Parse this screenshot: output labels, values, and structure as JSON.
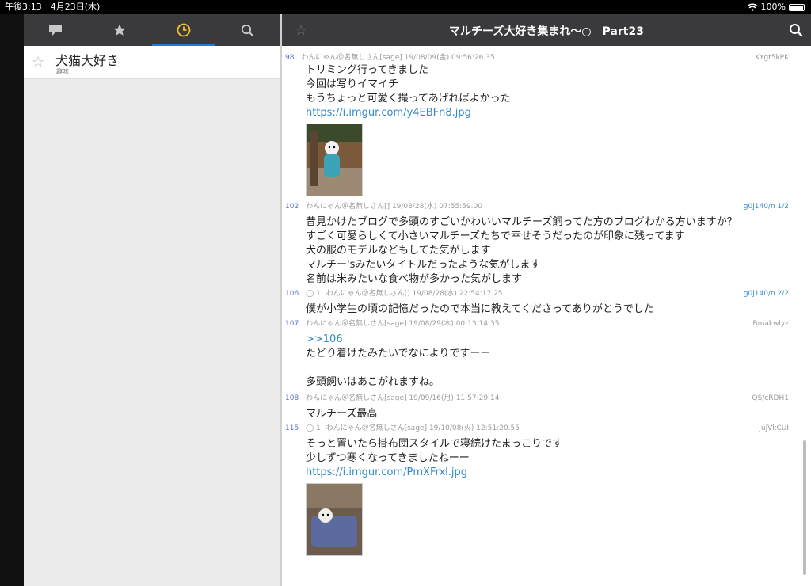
{
  "status_bar": {
    "time_date": "午後3:13　4月23日(木)",
    "battery": "100%"
  },
  "sidebar": {
    "tab_icons": [
      "speech-bubble-icon",
      "star-icon",
      "clock-icon",
      "search-icon"
    ],
    "items": [
      {
        "title": "犬猫大好き",
        "subtitle": "趣味"
      }
    ]
  },
  "thread": {
    "title": "マルチーズ大好き集まれ〜○　Part23",
    "posts": [
      {
        "num": "98",
        "reply": "",
        "meta": "わんにゃん＠名無しさん[sage]  19/08/09(金) 09:56:26.35",
        "id": "KYgt5kPK",
        "id_blue": false,
        "body": "トリミング行ってきました\n今回は写りイマイチ\nもうちょっと可愛く撮ってあげればよかった",
        "link": "https://i.imgur.com/y4EBFn8.jpg",
        "has_image": true
      },
      {
        "num": "102",
        "reply": "",
        "meta": "わんにゃん＠名無しさん[]  19/08/28(水) 07:55:59.00",
        "id": "g0j140/n 1/2",
        "id_blue": true,
        "body": "昔見かけたブログで多頭のすごいかわいいマルチーズ飼ってた方のブログわかる方いますか？\nすごく可愛らしくて小さいマルチーズたちで幸せそうだったのが印象に残ってます\n犬の服のモデルなどもしてた気がします\nマルチー'sみたいタイトルだったような気がします\n名前は米みたいな食べ物が多かった気がします",
        "link": "",
        "has_image": false
      },
      {
        "num": "106",
        "reply": "1",
        "meta": "わんにゃん＠名無しさん[]  19/08/28(水) 22:54:17.25",
        "id": "g0j140/n 2/2",
        "id_blue": true,
        "body": "僕が小学生の頃の記憶だったので本当に教えてくださってありがとうでした",
        "link": "",
        "has_image": false
      },
      {
        "num": "107",
        "reply": "",
        "meta": "わんにゃん＠名無しさん[sage]  19/08/29(木) 00:13:14.35",
        "id": "Bmakwlyz",
        "id_blue": false,
        "body": "たどり着けたみたいでなによりですーー\n\n多頭飼いはあこがれますね。",
        "quote": ">>106",
        "link": "",
        "has_image": false
      },
      {
        "num": "108",
        "reply": "",
        "meta": "わんにゃん＠名無しさん[sage]  19/09/16(月) 11:57:29.14",
        "id": "QS/cRDH1",
        "id_blue": false,
        "body": "マルチーズ最高",
        "link": "",
        "has_image": false
      },
      {
        "num": "115",
        "reply": "1",
        "meta": "わんにゃん＠名無しさん[sage]  19/10/08(火) 12:51:20.55",
        "id": "jujVkCUI",
        "id_blue": false,
        "body": "そっと置いたら掛布団スタイルで寝続けたまっこりです\n少しずつ寒くなってきましたねーー\n",
        "link": "https://i.imgur.com/PmXFrxl.jpg",
        "has_image": true
      }
    ]
  },
  "colors": {
    "accent_tab": "#f2c12e",
    "tab_underline": "#1f7ae0",
    "link": "#2f8ac9",
    "post_number": "#5b6fd6"
  }
}
